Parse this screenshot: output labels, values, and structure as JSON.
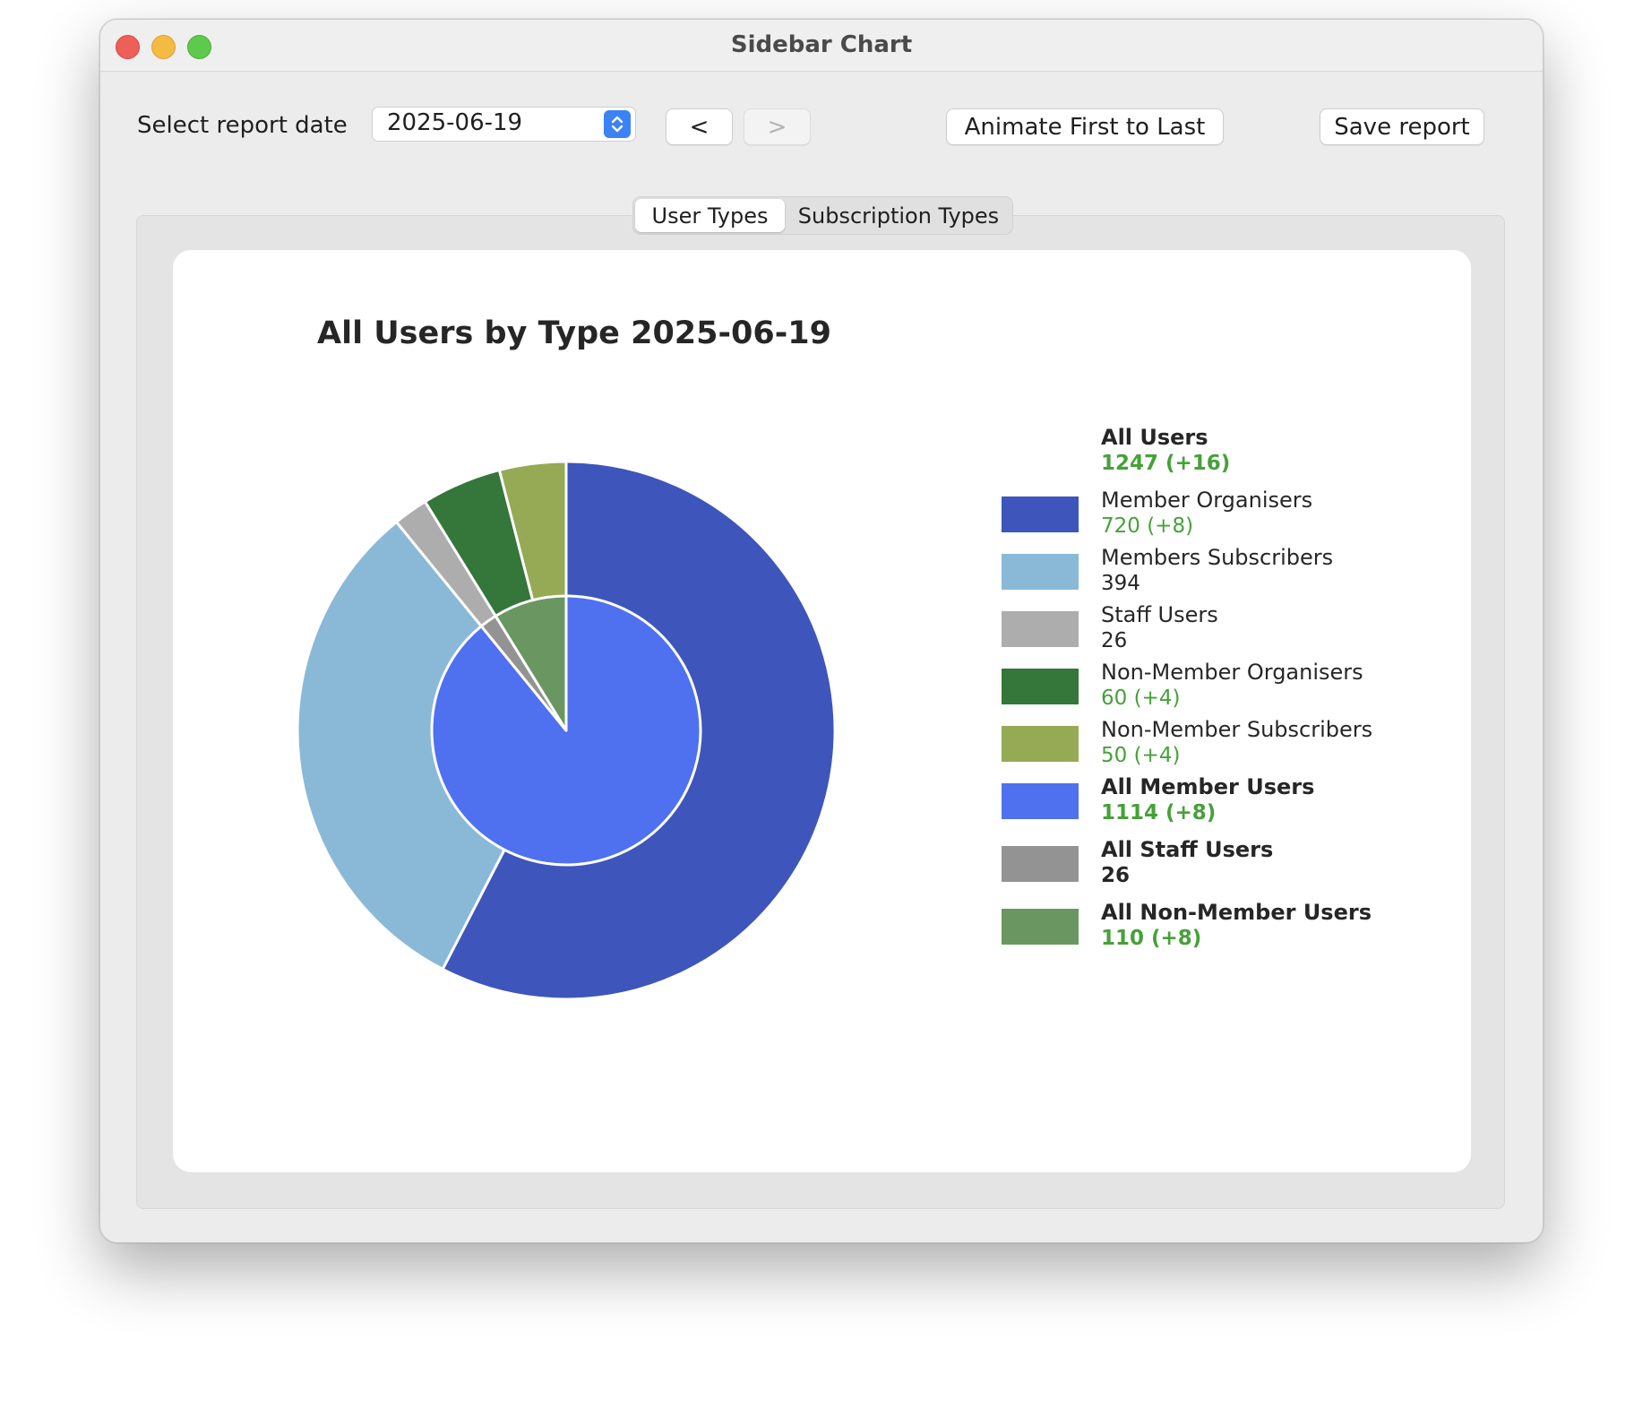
{
  "window": {
    "title": "Sidebar Chart"
  },
  "toolbar": {
    "date_label": "Select report date",
    "date_value": "2025-06-19",
    "prev_label": "<",
    "next_label": ">",
    "animate_label": "Animate First to Last",
    "save_label": "Save report"
  },
  "tabs": [
    {
      "label": "User Types",
      "active": true
    },
    {
      "label": "Subscription Types",
      "active": false
    }
  ],
  "colors": {
    "accent": "#3b82f6",
    "positive_delta": "#47a03a"
  },
  "chart_data": {
    "type": "pie",
    "title": "All Users by Type 2025-06-19",
    "total": {
      "label": "All Users",
      "value": "1247 (+16)"
    },
    "outer_ring": [
      {
        "name": "Member Organisers",
        "value": 720,
        "display": "720 (+8)",
        "color": "#3e55bb"
      },
      {
        "name": "Members Subscribers",
        "value": 394,
        "display": "394",
        "color": "#8ab9d8"
      },
      {
        "name": "Staff Users",
        "value": 26,
        "display": "26",
        "color": "#adadad"
      },
      {
        "name": "Non-Member Organisers",
        "value": 60,
        "display": "60 (+4)",
        "color": "#35763b"
      },
      {
        "name": "Non-Member Subscribers",
        "value": 50,
        "display": "50 (+4)",
        "color": "#96aa55"
      }
    ],
    "inner_ring": [
      {
        "name": "All Member Users",
        "value": 1114,
        "display": "1114 (+8)",
        "color": "#4f71ef"
      },
      {
        "name": "All Staff Users",
        "value": 26,
        "display": "26",
        "color": "#939393"
      },
      {
        "name": "All Non-Member Users",
        "value": 110,
        "display": "110 (+8)",
        "color": "#6a9662"
      }
    ]
  }
}
